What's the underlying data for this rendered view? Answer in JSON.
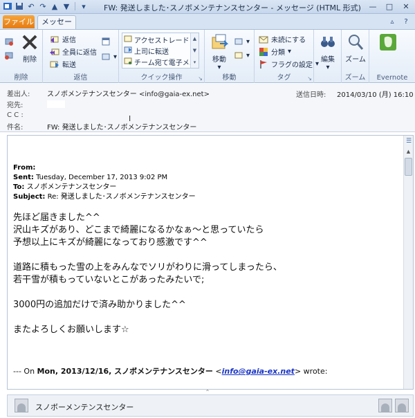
{
  "window": {
    "title": "FW: 発送しました･スノボメンテナンスセンター  -  メッセージ (HTML 形式)",
    "minimize": "—",
    "maximize": "□",
    "close": "✕"
  },
  "tabs": {
    "file": "ファイル",
    "message": "メッセージ"
  },
  "ribbon": {
    "delete_group": {
      "label": "削除",
      "delete": "削除"
    },
    "respond_group": {
      "label": "返信",
      "reply": "返信",
      "reply_all": "全員に返信",
      "forward": "転送"
    },
    "quick_steps_group": {
      "label": "クイック操作",
      "items": [
        "アクセストレード -...",
        "上司に転送",
        "チーム宛て電子メ..."
      ]
    },
    "move_group": {
      "label": "移動",
      "move": "移動"
    },
    "tags_group": {
      "label": "タグ",
      "unread": "未読にする",
      "categorize": "分類",
      "follow_up": "フラグの設定"
    },
    "editing_group": {
      "label": "編集",
      "editing": "編集"
    },
    "zoom_group": {
      "label": "ズーム",
      "zoom": "ズーム"
    },
    "evernote_group": {
      "label": "Evernote"
    }
  },
  "header": {
    "from_label": "差出人:",
    "from_value": "スノボメンテナンスセンター <info@gaia-ex.net>",
    "to_label": "宛先:",
    "cc_label": "C C :",
    "subject_label": "件名:",
    "subject_value": "FW: 発送しました･スノボメンテナンスセンター",
    "sent_label": "送信日時:",
    "sent_value": "2014/03/10 (月) 16:10"
  },
  "quoted": {
    "from_label": "From:",
    "from_value": "",
    "sent_label": "Sent:",
    "sent_value": "Tuesday, December 17, 2013 9:02 PM",
    "to_label": "To:",
    "to_value": "スノボメンテナンスセンター",
    "subject_label": "Subject:",
    "subject_value": "Re: 発送しました･スノボメンテナンスセンター"
  },
  "message": {
    "lines": [
      "先ほど届きました^^",
      "沢山キズがあり、どこまで綺麗になるかなぁ～と思っていたら",
      "予想以上にキズが綺麗になっており感激です^^",
      "",
      "道路に積もった雪の上をみんなでソリがわりに滑ってしまったら、",
      "若干雪が積もっていないとこがあったみたいで;",
      "",
      "3000円の追加だけで済み助かりました^^",
      "",
      "またよろしくお願いします☆"
    ]
  },
  "original": {
    "prefix": "--- On ",
    "date": "Mon, 2013/12/16, スノボメンテナンスセンター",
    "lt": " <",
    "email": "info@gaia-ex.net",
    "gt": ">",
    "suffix": " wrote:"
  },
  "people_pane": {
    "name": "スノボーメンテンスセンター"
  },
  "colors": {
    "file_tab": "#e57a12",
    "link": "#1a35c8",
    "ribbon_bg": "#e3ecf7"
  }
}
